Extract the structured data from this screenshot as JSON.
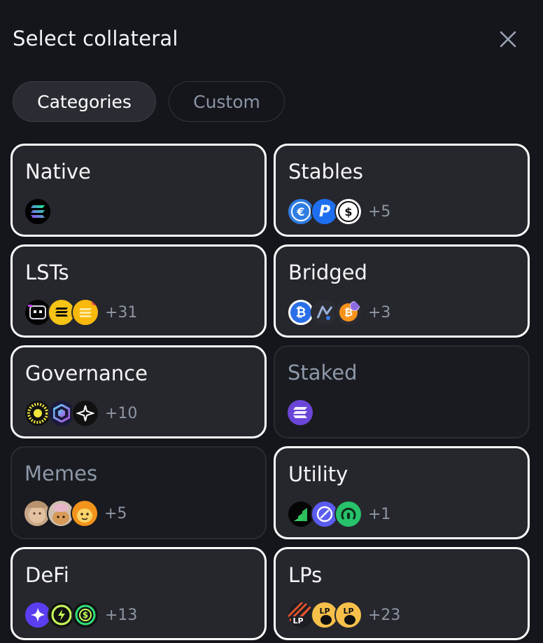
{
  "header": {
    "title": "Select collateral"
  },
  "tabs": [
    {
      "label": "Categories",
      "active": true
    },
    {
      "label": "Custom",
      "active": false
    }
  ],
  "categories": [
    {
      "name": "Native",
      "more": "",
      "enabled": true,
      "icons": [
        "solana-icon"
      ]
    },
    {
      "name": "Stables",
      "more": "+5",
      "enabled": true,
      "icons": [
        "euro-coin-icon",
        "paypal-usd-icon",
        "usdc-icon"
      ]
    },
    {
      "name": "LSTs",
      "more": "+31",
      "enabled": true,
      "icons": [
        "lst-pixel-icon",
        "lst-gold-icon",
        "lst-sunburst-icon"
      ]
    },
    {
      "name": "Bridged",
      "more": "+3",
      "enabled": true,
      "icons": [
        "bitcoin-icon",
        "bridge-chart-icon",
        "bridged-btc-icon"
      ]
    },
    {
      "name": "Governance",
      "more": "+10",
      "enabled": true,
      "icons": [
        "jupiter-icon",
        "hexagon-token-icon",
        "spark-token-icon"
      ]
    },
    {
      "name": "Staked",
      "more": "",
      "enabled": false,
      "icons": [
        "staked-sol-icon"
      ]
    },
    {
      "name": "Memes",
      "more": "+5",
      "enabled": false,
      "icons": [
        "meme-face-icon",
        "dog-hat-icon",
        "bonk-icon"
      ]
    },
    {
      "name": "Utility",
      "more": "+1",
      "enabled": true,
      "icons": [
        "chart-bars-icon",
        "link-token-icon",
        "green-token-icon"
      ]
    },
    {
      "name": "DeFi",
      "more": "+13",
      "enabled": true,
      "icons": [
        "drift-icon",
        "jito-icon",
        "jito-dollar-icon"
      ]
    },
    {
      "name": "LPs",
      "more": "+23",
      "enabled": true,
      "icons": [
        "lp-striped-icon",
        "lp-gold-icon",
        "lp-gold-two-icon"
      ]
    }
  ],
  "icon_text": {
    "euro": "€",
    "paypal": "P",
    "dollar": "$",
    "bitcoin": "₿",
    "lp": "LP"
  },
  "colors": {
    "background": "#15161b",
    "card": "#26272d",
    "card_disabled": "#1a1b20",
    "card_border": "#ffffff",
    "muted_text": "#8d96a3"
  }
}
